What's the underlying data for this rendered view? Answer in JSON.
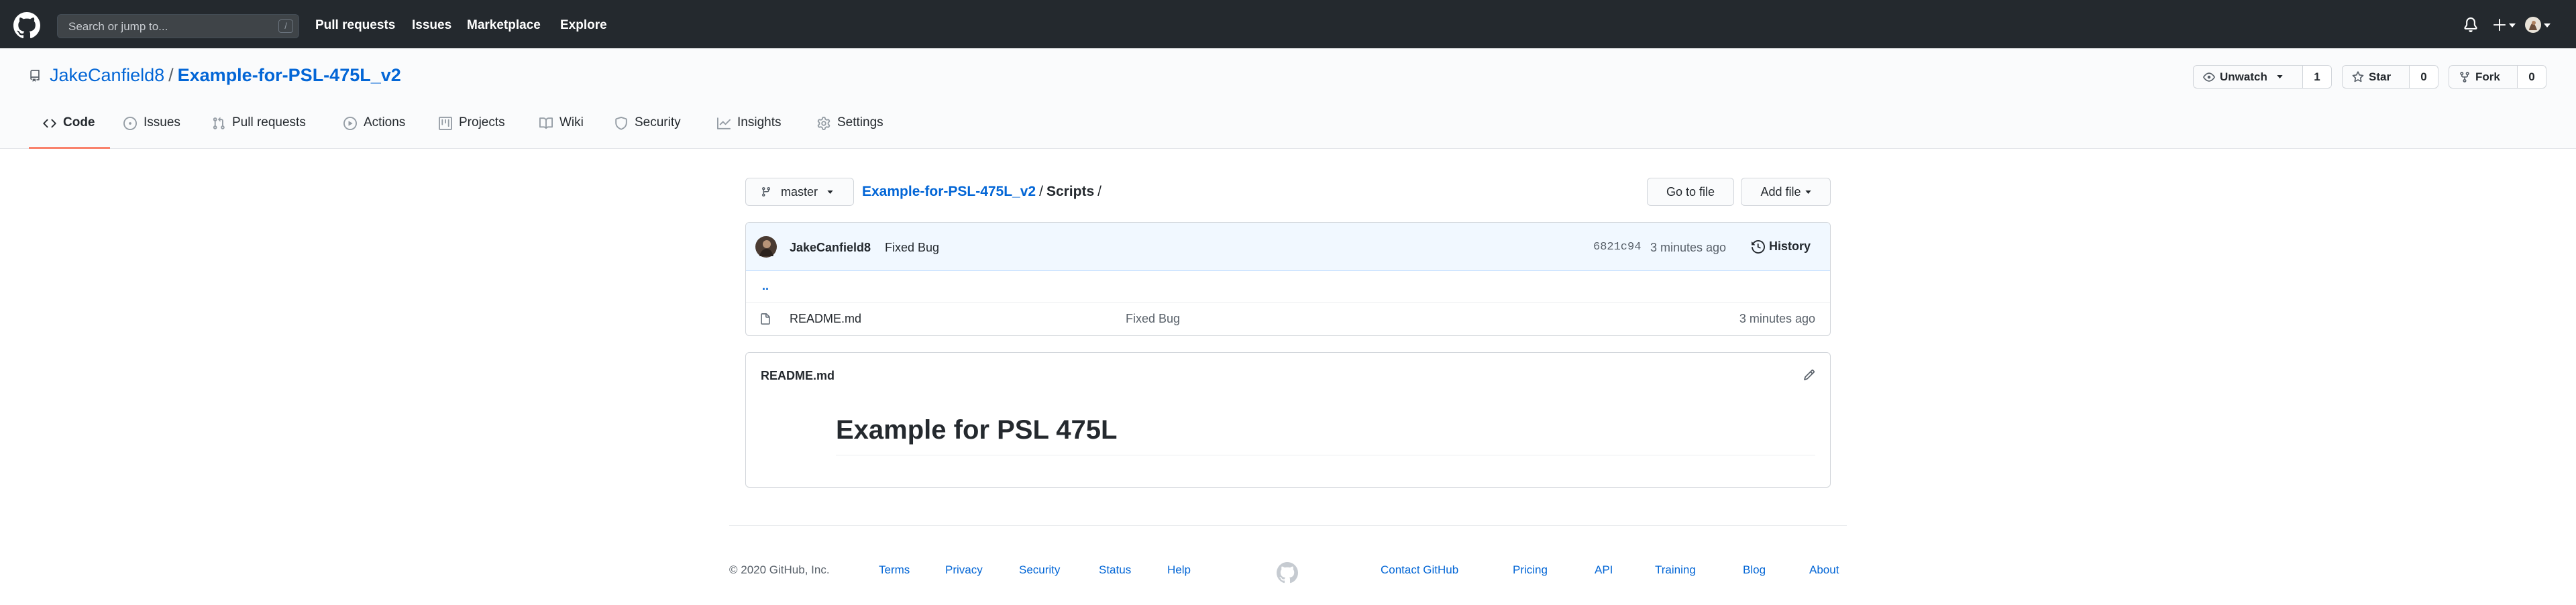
{
  "header": {
    "search_placeholder": "Search or jump to...",
    "search_key": "/",
    "nav": [
      "Pull requests",
      "Issues",
      "Marketplace",
      "Explore"
    ]
  },
  "repo": {
    "owner": "JakeCanfield8",
    "separator": "/",
    "name": "Example-for-PSL-475L_v2",
    "unwatch_label": "Unwatch",
    "unwatch_count": "1",
    "star_label": "Star",
    "star_count": "0",
    "fork_label": "Fork",
    "fork_count": "0"
  },
  "tabs": [
    {
      "label": "Code",
      "icon": "code-icon",
      "selected": true
    },
    {
      "label": "Issues",
      "icon": "issue-icon"
    },
    {
      "label": "Pull requests",
      "icon": "pull-request-icon"
    },
    {
      "label": "Actions",
      "icon": "play-icon"
    },
    {
      "label": "Projects",
      "icon": "project-icon"
    },
    {
      "label": "Wiki",
      "icon": "book-icon"
    },
    {
      "label": "Security",
      "icon": "shield-icon"
    },
    {
      "label": "Insights",
      "icon": "graph-icon"
    },
    {
      "label": "Settings",
      "icon": "gear-icon"
    }
  ],
  "main": {
    "branch": "master",
    "breadcrumb_repo": "Example-for-PSL-475L_v2",
    "breadcrumb_sep": "/",
    "breadcrumb_dir": "Scripts",
    "breadcrumb_trail": "/",
    "go_to_file": "Go to file",
    "add_file": "Add file"
  },
  "commit": {
    "author": "JakeCanfield8",
    "message": "Fixed Bug",
    "sha": "6821c94",
    "time": "3 minutes ago",
    "history_label": "History"
  },
  "files": {
    "parent_link": "..",
    "rows": [
      {
        "name": "README.md",
        "message": "Fixed Bug",
        "time": "3 minutes ago"
      }
    ]
  },
  "readme": {
    "filename": "README.md",
    "heading": "Example for PSL 475L"
  },
  "footer": {
    "copyright": "© 2020 GitHub, Inc.",
    "left_links": [
      "Terms",
      "Privacy",
      "Security",
      "Status",
      "Help"
    ],
    "right_links": [
      "Contact GitHub",
      "Pricing",
      "API",
      "Training",
      "Blog",
      "About"
    ]
  },
  "colors": {
    "header_bg": "#24292e",
    "link": "#0366d6",
    "tab_underline": "#f9826c",
    "commit_bar_bg": "#f1f8ff"
  }
}
